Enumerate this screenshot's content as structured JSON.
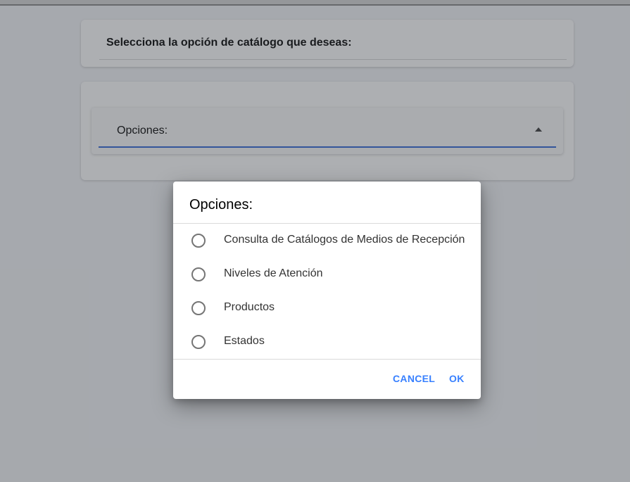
{
  "page": {
    "title_card_text": "Selecciona la opción de catálogo que deseas:",
    "select_label": "Opciones:"
  },
  "modal": {
    "header": "Opciones:",
    "options": [
      {
        "label": "Consulta de Catálogos de Medios de Recepción",
        "selected": false
      },
      {
        "label": "Niveles de Atención",
        "selected": false
      },
      {
        "label": "Productos",
        "selected": false
      },
      {
        "label": "Estados",
        "selected": false
      }
    ],
    "cancel_label": "CANCEL",
    "ok_label": "OK"
  },
  "colors": {
    "accent": "#3880ff",
    "underline": "#3a6fd8",
    "radio_border": "#757575"
  },
  "icons": {
    "select_caret": "caret-up-icon",
    "radio": "radio-unchecked-icon"
  }
}
